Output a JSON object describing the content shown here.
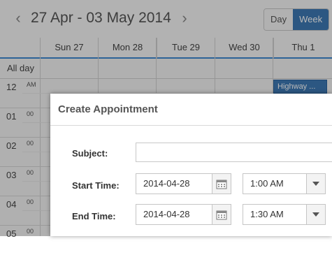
{
  "header": {
    "prev_arrow": "‹",
    "date_range": "27 Apr - 03 May 2014",
    "next_arrow": "›",
    "views": [
      {
        "label": "Day",
        "active": false
      },
      {
        "label": "Week",
        "active": true
      }
    ]
  },
  "days": [
    "Sun 27",
    "Mon 28",
    "Tue 29",
    "Wed 30",
    "Thu 1"
  ],
  "allday_label": "All day",
  "hours": [
    {
      "num": "12",
      "min": "AM"
    },
    {
      "num": "01",
      "min": "00"
    },
    {
      "num": "02",
      "min": "00"
    },
    {
      "num": "03",
      "min": "00"
    },
    {
      "num": "04",
      "min": "00"
    },
    {
      "num": "05",
      "min": "00"
    }
  ],
  "event": {
    "label": "Highway ..."
  },
  "dialog": {
    "title": "Create Appointment",
    "subject_label": "Subject:",
    "subject_value": "",
    "start_label": "Start Time:",
    "start_date": "2014-04-28",
    "start_time": "1:00 AM",
    "end_label": "End Time:",
    "end_date": "2014-04-28",
    "end_time": "1:30 AM"
  },
  "colors": {
    "accent": "#3e79b4",
    "header_border": "#3e8ad2"
  }
}
